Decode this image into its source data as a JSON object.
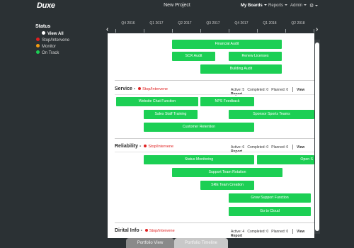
{
  "app": {
    "logo": "Duxe",
    "title": "New Project",
    "nav": {
      "boards": "My Boards",
      "reports": "Reports",
      "admin": "Admin",
      "settings_icon": "gear-icon"
    }
  },
  "sidebar": {
    "title": "Status",
    "items": [
      {
        "label": "View All",
        "color": "#ffffff"
      },
      {
        "label": "Stop/Intervene",
        "color": "#e02020"
      },
      {
        "label": "Monitor",
        "color": "#f39c12"
      },
      {
        "label": "On Track",
        "color": "#1ccf54"
      }
    ]
  },
  "timeline": {
    "quarters": [
      "Q4 2016",
      "Q1 2017",
      "Q2 2017",
      "Q3 2017",
      "Q4 2017",
      "Q1 2018",
      "Q2 2018"
    ],
    "prev_icon": "chevron-left-icon",
    "next_icon": "chevron-right-icon"
  },
  "sections": [
    {
      "name": "",
      "tasks": [
        "Financial Audit",
        "SOX Audit",
        "Renew Licenses",
        "Building Audit"
      ]
    },
    {
      "name": "Service",
      "status": "Stop/Intervene",
      "active": "Active: 5",
      "completed": "Completed: 0",
      "planned": "Planned: 0",
      "view_report": "View Report",
      "tasks": [
        "Website Chat Function",
        "NPS Feedback",
        "Sales Staff Training",
        "Sponsor Sports Teams",
        "Customer Retention"
      ]
    },
    {
      "name": "Reliability",
      "status": "Stop/Intervene",
      "active": "Active: 6",
      "completed": "Completed: 0",
      "planned": "Planned: 0",
      "view_report": "View Report",
      "tasks": [
        "Status Monitoring",
        "Open S",
        "Support Team Rotation",
        "SRE Team Creation",
        "Grow Support Function",
        "Go to Cloud"
      ]
    },
    {
      "name": "Dirital Info",
      "status": "Stop/Intervene",
      "active": "Active: 4",
      "completed": "Completed: 0",
      "planned": "Planned: 0",
      "view_report": "View Report",
      "tasks": []
    }
  ],
  "bottom_tabs": {
    "portfolio_view": "Portfolio View",
    "portfolio_timeline": "Portfolio Timeline"
  },
  "colors": {
    "bar": "#1ccf54",
    "dark": "#2b3134",
    "stop": "#e02020"
  }
}
